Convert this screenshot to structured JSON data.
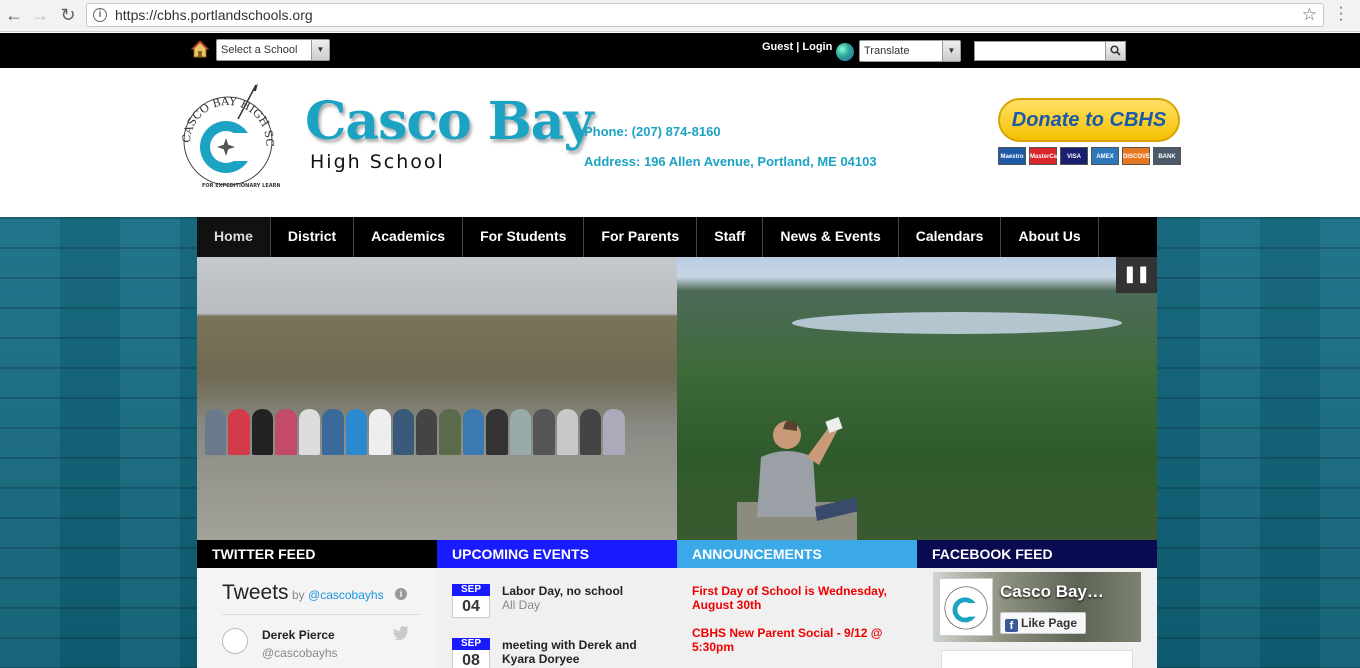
{
  "browser": {
    "back": "←",
    "forward": "→",
    "reload": "↻",
    "url": "https://cbhs.portlandschools.org",
    "star": "☆",
    "menu": "⋮"
  },
  "util_bar": {
    "select_school": "Select a School",
    "guest": "Guest",
    "sep": "|",
    "login": "Login",
    "translate": "Translate",
    "search_placeholder": ""
  },
  "header": {
    "name": "Casco Bay",
    "subtitle": "High School",
    "phone": "Phone: (207) 874-8160",
    "address": "Address: 196 Allen Avenue, Portland, ME 04103",
    "donate": "Donate to CBHS",
    "cards": [
      {
        "label": "Maestro",
        "color": "#1f5aa6"
      },
      {
        "label": "MasterCard",
        "color": "#d8262c"
      },
      {
        "label": "VISA",
        "color": "#1a1f71"
      },
      {
        "label": "AMEX",
        "color": "#2e77bc"
      },
      {
        "label": "DISCOVER",
        "color": "#e87722"
      },
      {
        "label": "BANK",
        "color": "#4a5a6a"
      }
    ]
  },
  "nav": {
    "items": [
      "Home",
      "District",
      "Academics",
      "For Students",
      "For Parents",
      "Staff",
      "News & Events",
      "Calendars",
      "About Us"
    ]
  },
  "slideshow": {
    "pause": "❚❚"
  },
  "columns": {
    "twitter": {
      "heading": "TWITTER FEED",
      "color": "#000000",
      "title": "Tweets",
      "by": "by",
      "handle_top": "@cascobayhs",
      "name": "Derek Pierce",
      "handle": "@cascobayhs"
    },
    "events": {
      "heading": "UPCOMING EVENTS",
      "color": "#1a1aff",
      "items": [
        {
          "month": "SEP",
          "day": "04",
          "title": "Labor Day, no school",
          "sub": "All Day"
        },
        {
          "month": "SEP",
          "day": "08",
          "title": "meeting with Derek and Kyara Doryee",
          "sub": ""
        }
      ]
    },
    "announcements": {
      "heading": "ANNOUNCEMENTS",
      "color": "#3ba8e8",
      "items": [
        "First Day of School is Wednesday, August 30th",
        "CBHS New Parent Social - 9/12 @ 5:30pm"
      ]
    },
    "facebook": {
      "heading": "FACEBOOK FEED",
      "color": "#0a0a50",
      "page_name": "Casco Bay…",
      "like": "Like Page"
    }
  }
}
